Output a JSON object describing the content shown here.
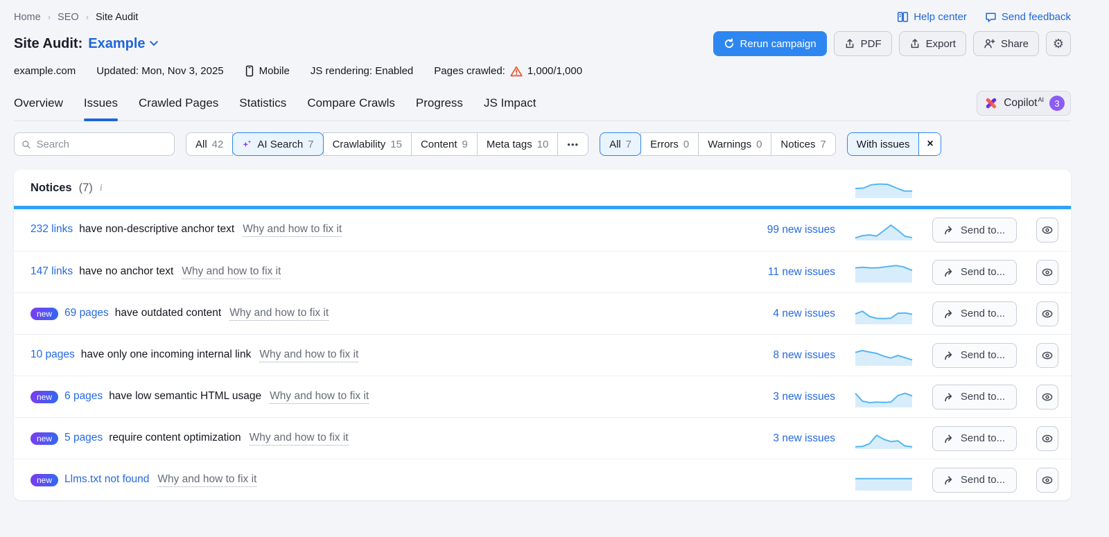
{
  "breadcrumb": {
    "items": [
      "Home",
      "SEO",
      "Site Audit"
    ]
  },
  "toplinks": {
    "help_center": "Help center",
    "send_feedback": "Send feedback"
  },
  "header": {
    "title_prefix": "Site Audit:",
    "project_name": "Example",
    "rerun_button": "Rerun campaign",
    "pdf_button": "PDF",
    "export_button": "Export",
    "share_button": "Share"
  },
  "meta": {
    "domain": "example.com",
    "updated": "Updated: Mon, Nov 3, 2025",
    "device": "Mobile",
    "js_rendering": "JS rendering: Enabled",
    "pages_crawled_label": "Pages crawled:",
    "pages_crawled_value": "1,000/1,000"
  },
  "tabs": {
    "items": [
      {
        "label": "Overview",
        "active": false
      },
      {
        "label": "Issues",
        "active": true
      },
      {
        "label": "Crawled Pages",
        "active": false
      },
      {
        "label": "Statistics",
        "active": false
      },
      {
        "label": "Compare Crawls",
        "active": false
      },
      {
        "label": "Progress",
        "active": false
      },
      {
        "label": "JS Impact",
        "active": false
      }
    ],
    "copilot": {
      "label": "Copilot",
      "superscript": "AI",
      "badge": "3"
    }
  },
  "filters": {
    "search_placeholder": "Search",
    "categories": [
      {
        "label": "All",
        "count": "42",
        "selected": false,
        "icon": null
      },
      {
        "label": "AI Search",
        "count": "7",
        "selected": true,
        "icon": "sparkles"
      },
      {
        "label": "Crawlability",
        "count": "15",
        "selected": false,
        "icon": null
      },
      {
        "label": "Content",
        "count": "9",
        "selected": false,
        "icon": null
      },
      {
        "label": "Meta tags",
        "count": "10",
        "selected": false,
        "icon": null
      }
    ],
    "more_label": "•••",
    "severities": [
      {
        "label": "All",
        "count": "7",
        "selected": true
      },
      {
        "label": "Errors",
        "count": "0",
        "selected": false
      },
      {
        "label": "Warnings",
        "count": "0",
        "selected": false
      },
      {
        "label": "Notices",
        "count": "7",
        "selected": false
      }
    ],
    "with_issues_label": "With issues",
    "with_issues_close": "×"
  },
  "section": {
    "title": "Notices",
    "count": "(7)",
    "sparkline": [
      48,
      50,
      68,
      72,
      70,
      52,
      35,
      34
    ]
  },
  "row_labels": {
    "send_to": "Send to...",
    "fix": "Why and how to fix it"
  },
  "rows": [
    {
      "badge": false,
      "link": "232 links",
      "desc": "have non-descriptive anchor text",
      "fix": "Why and how to fix it",
      "new_issues": "99 new issues",
      "sparkline": [
        10,
        22,
        26,
        20,
        48,
        78,
        50,
        18,
        12
      ]
    },
    {
      "badge": false,
      "link": "147 links",
      "desc": "have no anchor text",
      "fix": "Why and how to fix it",
      "new_issues": "11 new issues",
      "sparkline": [
        76,
        79,
        75,
        77,
        83,
        88,
        80,
        62
      ]
    },
    {
      "badge": true,
      "badge_label": "new",
      "link": "69 pages",
      "desc": "have outdated content",
      "fix": "Why and how to fix it",
      "new_issues": "4 new issues",
      "sparkline": [
        52,
        66,
        38,
        28,
        27,
        29,
        55,
        57,
        50
      ]
    },
    {
      "badge": false,
      "link": "10 pages",
      "desc": "have only one incoming internal link",
      "fix": "Why and how to fix it",
      "new_issues": "8 new issues",
      "sparkline": [
        68,
        78,
        70,
        63,
        48,
        38,
        52,
        40,
        28
      ]
    },
    {
      "badge": true,
      "badge_label": "new",
      "link": "6 pages",
      "desc": "have low semantic HTML usage",
      "fix": "Why and how to fix it",
      "new_issues": "3 new issues",
      "sparkline": [
        72,
        30,
        22,
        25,
        23,
        25,
        60,
        72,
        58
      ]
    },
    {
      "badge": true,
      "badge_label": "new",
      "link": "5 pages",
      "desc": "require content optimization",
      "fix": "Why and how to fix it",
      "new_issues": "3 new issues",
      "sparkline": [
        8,
        10,
        25,
        70,
        48,
        36,
        40,
        12,
        8
      ]
    },
    {
      "badge": true,
      "badge_label": "new",
      "link": "Llms.txt not found",
      "desc": "",
      "fix": "Why and how to fix it",
      "new_issues": "",
      "sparkline": [
        60,
        60,
        60,
        60,
        60,
        60
      ]
    }
  ],
  "colors": {
    "accent_blue": "#2e87f0",
    "link_blue": "#2469e3",
    "section_bar_blue": "#30a3f0",
    "sparkline_line": "#56b5f2",
    "sparkline_fill": "#d8edfb",
    "warning_orange": "#e8552e",
    "copilot_purple": "#8b5cf6",
    "badge_gradient_start": "#7d3bf0",
    "badge_gradient_end": "#2f6af0",
    "page_background": "#f4f5f8"
  }
}
